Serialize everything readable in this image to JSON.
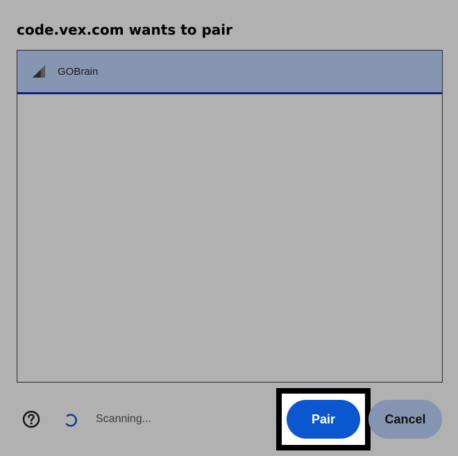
{
  "dialog": {
    "title": "code.vex.com wants to pair"
  },
  "devices": [
    {
      "name": "GOBrain",
      "icon": "signal-strength-icon",
      "selected": true
    }
  ],
  "footer": {
    "help_icon": "help-circle-icon",
    "status": "Scanning...",
    "pair_label": "Pair",
    "cancel_label": "Cancel"
  },
  "colors": {
    "background": "#b1b1b1",
    "selected_row": "#8695b1",
    "selected_underline": "#0f1e86",
    "pair_button": "#0b57d0",
    "cancel_button": "#8595b1"
  }
}
